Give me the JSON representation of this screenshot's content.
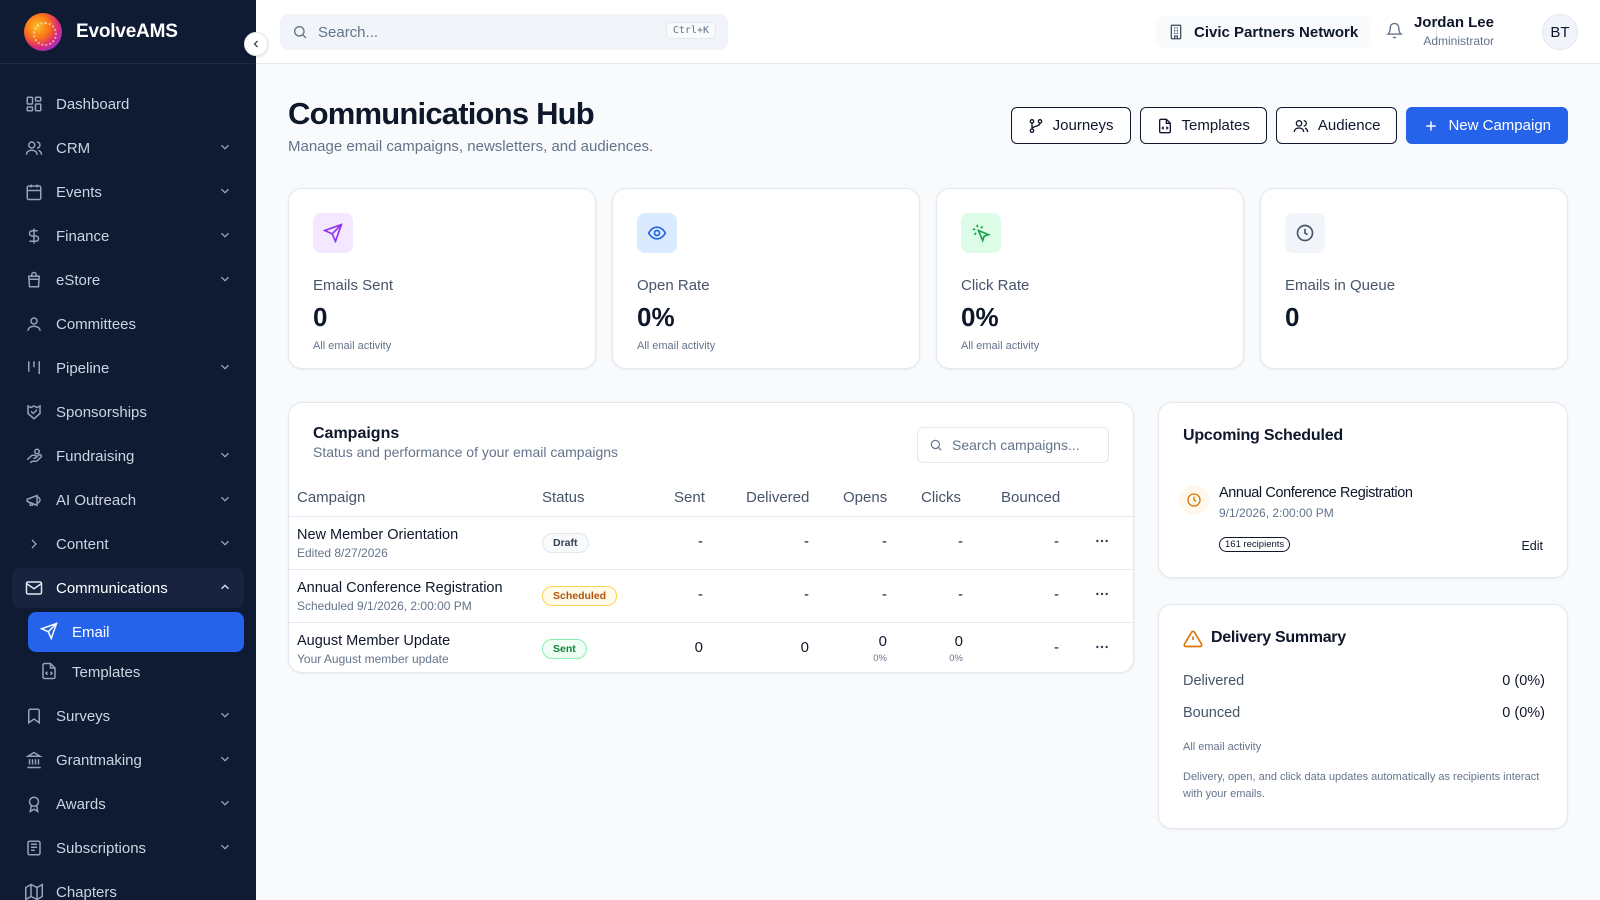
{
  "app": {
    "name": "EvolveAMS"
  },
  "topbar": {
    "search_placeholder": "Search...",
    "shortcut": "Ctrl+K",
    "org_name": "Civic Partners Network",
    "user_name": "Jordan Lee",
    "user_role": "Administrator",
    "avatar_initials": "BT"
  },
  "sidebar": {
    "items": [
      {
        "label": "Dashboard",
        "icon": "dashboard-icon"
      },
      {
        "label": "CRM",
        "icon": "users-icon"
      },
      {
        "label": "Events",
        "icon": "calendar-icon"
      },
      {
        "label": "Finance",
        "icon": "dollar-icon"
      },
      {
        "label": "eStore",
        "icon": "bag-icon"
      },
      {
        "label": "Committees",
        "icon": "people-icon"
      },
      {
        "label": "Pipeline",
        "icon": "pipeline-icon"
      },
      {
        "label": "Sponsorships",
        "icon": "handshake-icon"
      },
      {
        "label": "Fundraising",
        "icon": "hand-coins-icon"
      },
      {
        "label": "AI Outreach",
        "icon": "megaphone-icon"
      },
      {
        "label": "Content",
        "icon": "chevron-right-icon"
      },
      {
        "label": "Communications",
        "icon": "mail-icon"
      },
      {
        "label": "Surveys",
        "icon": "bookmark-icon"
      },
      {
        "label": "Grantmaking",
        "icon": "landmark-icon"
      },
      {
        "label": "Awards",
        "icon": "award-icon"
      },
      {
        "label": "Subscriptions",
        "icon": "newspaper-icon"
      },
      {
        "label": "Chapters",
        "icon": "map-icon"
      }
    ],
    "sub_items": [
      {
        "label": "Email",
        "icon": "send-icon"
      },
      {
        "label": "Templates",
        "icon": "file-code-icon"
      }
    ]
  },
  "page": {
    "title": "Communications Hub",
    "subtitle": "Manage email campaigns, newsletters, and audiences.",
    "actions": {
      "journeys": "Journeys",
      "templates": "Templates",
      "audience": "Audience",
      "new_campaign": "New Campaign"
    }
  },
  "stats": [
    {
      "label": "Emails Sent",
      "value": "0",
      "note": "All email activity",
      "icon": "send-icon",
      "color": "#9333ea"
    },
    {
      "label": "Open Rate",
      "value": "0%",
      "note": "All email activity",
      "icon": "eye-icon",
      "color": "#2563eb"
    },
    {
      "label": "Click Rate",
      "value": "0%",
      "note": "All email activity",
      "icon": "pointer-click-icon",
      "color": "#16a34a"
    },
    {
      "label": "Emails in Queue",
      "value": "0",
      "note": "",
      "icon": "clock-icon",
      "color": "#475569"
    }
  ],
  "campaigns": {
    "title": "Campaigns",
    "subtitle": "Status and performance of your email campaigns",
    "search_placeholder": "Search campaigns...",
    "columns": [
      "Campaign",
      "Status",
      "Sent",
      "Delivered",
      "Opens",
      "Clicks",
      "Bounced"
    ],
    "rows": [
      {
        "name": "New Member Orientation",
        "meta": "Edited 8/27/2026",
        "status": "Draft",
        "sent": "-",
        "delivered": "-",
        "opens": "-",
        "opens_pct": "",
        "clicks": "-",
        "clicks_pct": "",
        "bounced": "-"
      },
      {
        "name": "Annual Conference Registration",
        "meta": "Scheduled 9/1/2026, 2:00:00 PM",
        "status": "Scheduled",
        "sent": "-",
        "delivered": "-",
        "opens": "-",
        "opens_pct": "",
        "clicks": "-",
        "clicks_pct": "",
        "bounced": "-"
      },
      {
        "name": "August Member Update",
        "meta": "Your August member update",
        "status": "Sent",
        "sent": "0",
        "delivered": "0",
        "opens": "0",
        "opens_pct": "0%",
        "clicks": "0",
        "clicks_pct": "0%",
        "bounced": "-"
      }
    ]
  },
  "upcoming": {
    "title": "Upcoming Scheduled",
    "item_name": "Annual Conference Registration",
    "item_date": "9/1/2026, 2:00:00 PM",
    "recipients": "161 recipients",
    "edit": "Edit"
  },
  "delivery": {
    "title": "Delivery Summary",
    "rows": [
      {
        "label": "Delivered",
        "value": "0 (0%)"
      },
      {
        "label": "Bounced",
        "value": "0 (0%)"
      }
    ],
    "note": "All email activity",
    "footer": "Delivery, open, and click data updates automatically as recipients interact with your emails."
  }
}
